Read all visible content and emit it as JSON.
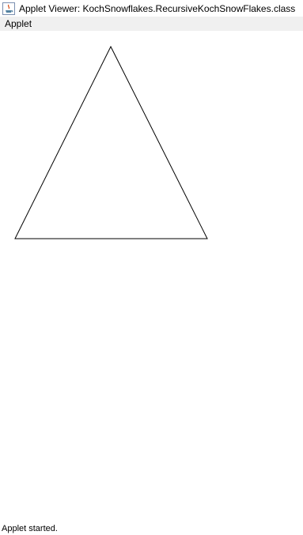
{
  "window": {
    "title": "Applet Viewer: KochSnowflakes.RecursiveKochSnowFlakes.class",
    "icon": "java-icon"
  },
  "menu": {
    "items": [
      {
        "label": "Applet"
      }
    ]
  },
  "applet": {
    "shape": "triangle",
    "stroke_color": "#000000",
    "background": "#ffffff"
  },
  "status": {
    "text": "Applet started."
  }
}
